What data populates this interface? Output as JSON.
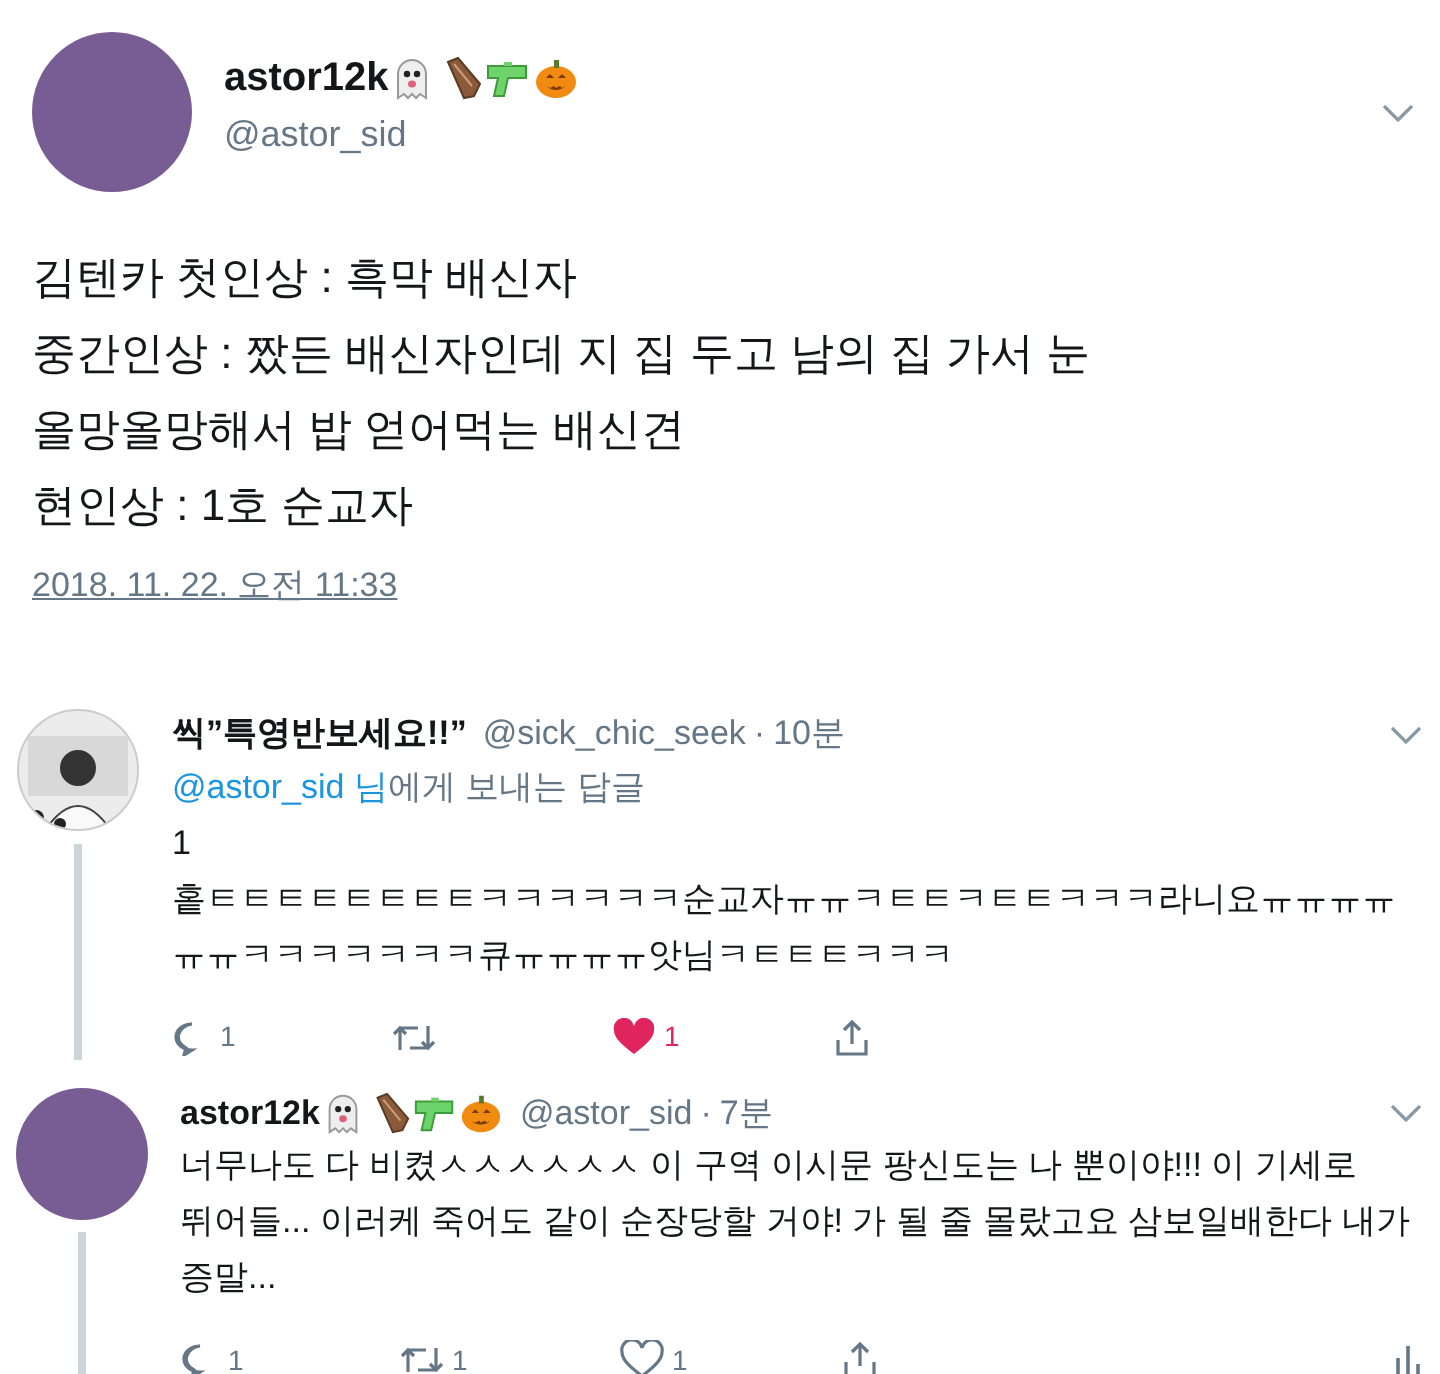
{
  "tweet": {
    "author": {
      "name": "astor12k",
      "handle": "@astor_sid",
      "emoji_badges": true
    },
    "text_lines": [
      "김텐카 첫인상 : 흑막 배신자",
      "중간인상 : 짰든 배신자인데 지 집 두고 남의 집 가서 눈",
      "올망올망해서 밥 얻어먹는 배신견",
      "현인상 : 1호 순교자"
    ],
    "date": "2018. 11. 22. 오전 11:33"
  },
  "replies": [
    {
      "name": "씩”특영반보세요!!”",
      "emoji_badges": false,
      "handle": "@sick_chic_seek",
      "separator": "·",
      "time": "10분",
      "reply_to": {
        "mention": "@astor_sid 님",
        "suffix": "에게 보내는 답글"
      },
      "text_lines": [
        "1",
        "홑ㅌㅌㅌㅌㅌㅌㅌㅌㅋㅋㅋㅋㅋㅋ순교자ㅠㅠㅋㅌㅌㅋㅌㅌㅋㅋㅋ라니요ㅠㅠㅠㅠㅠㅠㅋㅋㅋㅋㅋㅋㅋ큐ㅠㅠㅠㅠ앗님ㅋㅌㅌㅌㅋㅋㅋ"
      ],
      "thread_line": true,
      "replies_count": "1",
      "likes_count": "1",
      "liked": true,
      "analytics": false
    },
    {
      "name": "astor12k",
      "emoji_badges": true,
      "handle": "@astor_sid",
      "separator": "·",
      "time": "7분",
      "text_lines": [
        "너무나도 다 비켰ㅅㅅㅅㅅㅅㅅ 이 구역 이시문 팡신도는 나 뿐이야!!! 이 기세로 뛰어들... 이러케 죽어도 같이 순장당할 거야! 가 될 줄 몰랐고요 삼보일배한다 내가 증말..."
      ],
      "thread_line": true,
      "replies_count": "1",
      "retweets_count": "1",
      "likes_count": "1",
      "liked": false,
      "analytics": true
    }
  ]
}
